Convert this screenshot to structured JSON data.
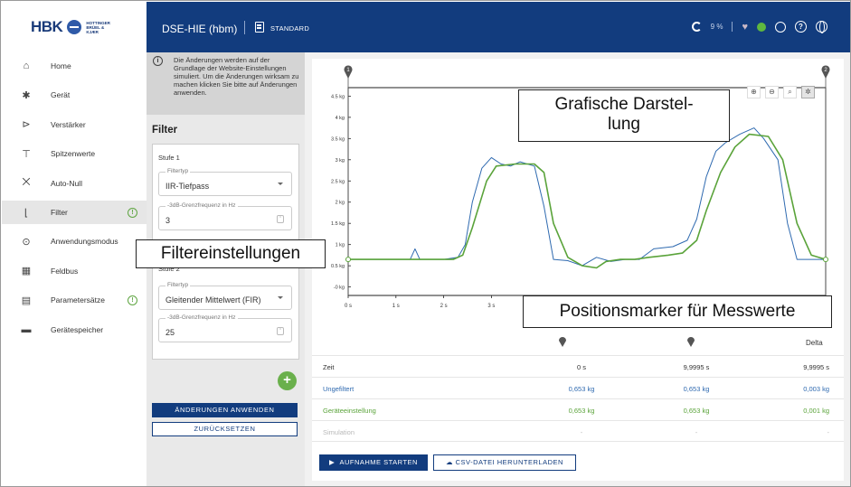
{
  "brand": {
    "name": "HBK",
    "sub": "HOTTINGER BRÜEL & KJÆR"
  },
  "topbar": {
    "device": "DSE-HIE (hbm)",
    "mode": "STANDARD",
    "percent": "9 %"
  },
  "sidebar": {
    "items": [
      {
        "label": "Home",
        "icon": "home-icon"
      },
      {
        "label": "Gerät",
        "icon": "gear-icon"
      },
      {
        "label": "Verstärker",
        "icon": "amplifier-icon"
      },
      {
        "label": "Spitzenwerte",
        "icon": "peak-icon"
      },
      {
        "label": "Auto-Null",
        "icon": "auto-zero-icon"
      },
      {
        "label": "Filter",
        "icon": "filter-icon",
        "active": true,
        "warning": true
      },
      {
        "label": "Anwendungsmodus",
        "icon": "target-icon"
      },
      {
        "label": "Feldbus",
        "icon": "fieldbus-icon"
      },
      {
        "label": "Parametersätze",
        "icon": "document-icon",
        "warning": true
      },
      {
        "label": "Gerätespeicher",
        "icon": "folder-icon"
      }
    ]
  },
  "filter_panel": {
    "notice": "Die Änderungen werden auf der Grundlage der Website-Einstellungen simuliert. Um die Änderungen wirksam zu machen klicken Sie bitte auf Änderungen anwenden.",
    "title": "Filter",
    "stage1": {
      "label": "Stufe 1",
      "type_label": "Filtertyp",
      "type_value": "IIR-Tiefpass",
      "freq_label": "-3dB-Grenzfrequenz in Hz",
      "freq_value": "3"
    },
    "stage2": {
      "label": "Stufe 2",
      "type_label": "Filtertyp",
      "type_value": "Gleitender Mittelwert (FIR)",
      "freq_label": "-3dB-Grenzfrequenz in Hz",
      "freq_value": "25"
    },
    "add_label": "+",
    "apply_label": "ÄNDERUNGEN ANWENDEN",
    "reset_label": "ZURÜCKSETZEN"
  },
  "chart_data": {
    "type": "line",
    "x_ticks": [
      "0 s",
      "1 s",
      "2 s",
      "3 s"
    ],
    "y_ticks": [
      "-0 kg",
      "0.5 kg",
      "1 kg",
      "1.5 kg",
      "2 kg",
      "2.5 kg",
      "3 kg",
      "3.5 kg",
      "4 kg",
      "4.5 kg"
    ],
    "ylim": [
      -0.2,
      4.7
    ],
    "xlim": [
      0,
      10
    ],
    "marker1": "1",
    "marker2": "2",
    "series": [
      {
        "color": "#2f6ab0",
        "x": [
          0,
          0.7,
          1.3,
          1.4,
          1.5,
          2.0,
          2.3,
          2.45,
          2.6,
          2.8,
          3.0,
          3.2,
          3.4,
          3.6,
          3.9,
          4.1,
          4.3,
          4.6,
          4.9,
          5.2,
          5.5,
          5.8,
          6.1,
          6.4,
          6.8,
          7.1,
          7.3,
          7.5,
          7.7,
          7.9,
          8.2,
          8.5,
          8.7,
          9.0,
          9.2,
          9.4,
          9.7,
          10
        ],
        "y": [
          0.65,
          0.65,
          0.65,
          0.9,
          0.65,
          0.65,
          0.7,
          1.0,
          2.0,
          2.8,
          3.05,
          2.9,
          2.85,
          2.95,
          2.85,
          1.9,
          0.65,
          0.62,
          0.5,
          0.7,
          0.6,
          0.65,
          0.65,
          0.9,
          0.95,
          1.1,
          1.6,
          2.6,
          3.2,
          3.4,
          3.6,
          3.75,
          3.5,
          3.0,
          1.5,
          0.65,
          0.65,
          0.65
        ]
      },
      {
        "color": "#5aa33a",
        "x": [
          0,
          2.2,
          2.4,
          2.6,
          2.9,
          3.1,
          3.5,
          3.9,
          4.1,
          4.3,
          4.6,
          4.9,
          5.2,
          5.4,
          5.7,
          6.0,
          6.3,
          6.7,
          7.0,
          7.3,
          7.5,
          7.8,
          8.1,
          8.4,
          8.8,
          9.1,
          9.4,
          9.7,
          10
        ],
        "y": [
          0.65,
          0.65,
          0.75,
          1.4,
          2.5,
          2.85,
          2.9,
          2.9,
          2.7,
          1.5,
          0.7,
          0.5,
          0.45,
          0.6,
          0.65,
          0.65,
          0.7,
          0.75,
          0.8,
          1.1,
          1.8,
          2.7,
          3.3,
          3.6,
          3.55,
          3.0,
          1.5,
          0.75,
          0.65
        ]
      }
    ]
  },
  "table": {
    "headers": [
      "Zeit",
      "0 s",
      "9,9995 s",
      "9,9995 s"
    ],
    "delta_label": "Delta",
    "rows": [
      {
        "name": "Ungefiltert",
        "v1": "0,653 kg",
        "v2": "0,653 kg",
        "delta": "0,003 kg"
      },
      {
        "name": "Geräteeinstellung",
        "v1": "0,653 kg",
        "v2": "0,653 kg",
        "delta": "0,001 kg"
      },
      {
        "name": "Simulation",
        "v1": "-",
        "v2": "-",
        "delta": "-"
      }
    ]
  },
  "actions": {
    "record_label": "AUFNAHME STARTEN",
    "csv_label": "CSV-DATEI HERUNTERLADEN"
  },
  "callouts": {
    "chart": "Grafische Darstel-\nlung",
    "filter": "Filtereinstellungen",
    "marker": "Positionsmarker für Messwerte"
  }
}
